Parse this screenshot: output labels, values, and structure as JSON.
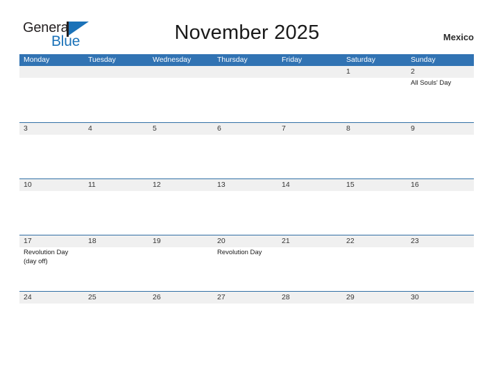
{
  "brand": {
    "word1": "General",
    "word2": "Blue",
    "flag_icon": "flag-triangle-icon",
    "accent_color": "#1b72b8"
  },
  "header": {
    "title": "November 2025",
    "country": "Mexico"
  },
  "colors": {
    "header_blue": "#3173b3",
    "row_separator_blue": "#2e6da4",
    "date_band_gray": "#f0f0f0",
    "page_background": "#ffffff"
  },
  "calendar": {
    "day_headers": [
      "Monday",
      "Tuesday",
      "Wednesday",
      "Thursday",
      "Friday",
      "Saturday",
      "Sunday"
    ],
    "weeks": [
      {
        "days": [
          {
            "num": "",
            "events": []
          },
          {
            "num": "",
            "events": []
          },
          {
            "num": "",
            "events": []
          },
          {
            "num": "",
            "events": []
          },
          {
            "num": "",
            "events": []
          },
          {
            "num": "1",
            "events": []
          },
          {
            "num": "2",
            "events": [
              "All Souls' Day"
            ]
          }
        ]
      },
      {
        "days": [
          {
            "num": "3",
            "events": []
          },
          {
            "num": "4",
            "events": []
          },
          {
            "num": "5",
            "events": []
          },
          {
            "num": "6",
            "events": []
          },
          {
            "num": "7",
            "events": []
          },
          {
            "num": "8",
            "events": []
          },
          {
            "num": "9",
            "events": []
          }
        ]
      },
      {
        "days": [
          {
            "num": "10",
            "events": []
          },
          {
            "num": "11",
            "events": []
          },
          {
            "num": "12",
            "events": []
          },
          {
            "num": "13",
            "events": []
          },
          {
            "num": "14",
            "events": []
          },
          {
            "num": "15",
            "events": []
          },
          {
            "num": "16",
            "events": []
          }
        ]
      },
      {
        "days": [
          {
            "num": "17",
            "events": [
              "Revolution Day",
              "(day off)"
            ]
          },
          {
            "num": "18",
            "events": []
          },
          {
            "num": "19",
            "events": []
          },
          {
            "num": "20",
            "events": [
              "Revolution Day"
            ]
          },
          {
            "num": "21",
            "events": []
          },
          {
            "num": "22",
            "events": []
          },
          {
            "num": "23",
            "events": []
          }
        ]
      },
      {
        "days": [
          {
            "num": "24",
            "events": []
          },
          {
            "num": "25",
            "events": []
          },
          {
            "num": "26",
            "events": []
          },
          {
            "num": "27",
            "events": []
          },
          {
            "num": "28",
            "events": []
          },
          {
            "num": "29",
            "events": []
          },
          {
            "num": "30",
            "events": []
          }
        ]
      }
    ]
  }
}
